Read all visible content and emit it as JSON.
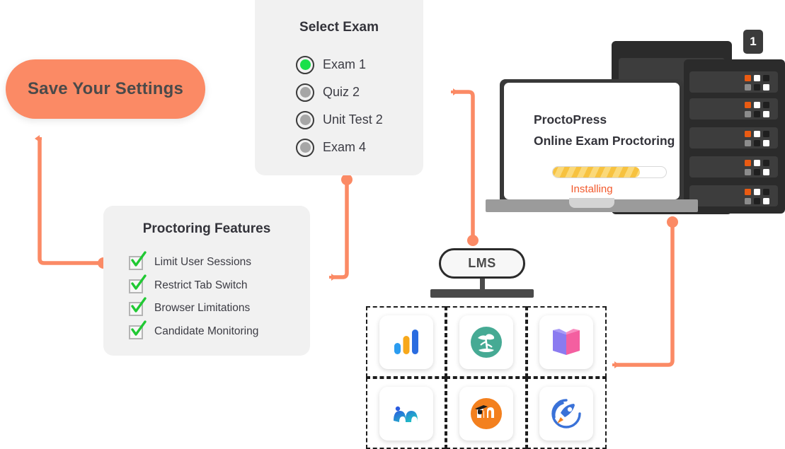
{
  "save_button": {
    "label": "Save Your Settings",
    "color": "#fb8a65"
  },
  "select_exam_card": {
    "title": "Select Exam",
    "options": [
      {
        "label": "Exam 1",
        "selected": true
      },
      {
        "label": "Quiz 2",
        "selected": false
      },
      {
        "label": "Unit Test 2",
        "selected": false
      },
      {
        "label": "Exam 4",
        "selected": false
      }
    ],
    "selected_color": "#18e049"
  },
  "features_card": {
    "title": "Proctoring Features",
    "items": [
      {
        "label": "Limit User Sessions",
        "checked": true
      },
      {
        "label": "Restrict Tab Switch",
        "checked": true
      },
      {
        "label": "Browser Limitations",
        "checked": true
      },
      {
        "label": "Candidate Monitoring",
        "checked": true
      }
    ],
    "check_color": "#20c933"
  },
  "laptop": {
    "app_name": "ProctoPress",
    "app_subtitle": "Online Exam Proctoring",
    "status": "Installing",
    "status_color": "#f2592c",
    "progress_percent": 77,
    "progress_color": "#f7c23f"
  },
  "server_badge": {
    "number": "1"
  },
  "lms": {
    "label": "LMS"
  },
  "tiles": [
    {
      "name": "bar-chart-app"
    },
    {
      "name": "bonsai-tree-app"
    },
    {
      "name": "open-book-app"
    },
    {
      "name": "wave-m-app"
    },
    {
      "name": "moodle-app"
    },
    {
      "name": "rocket-app"
    }
  ],
  "connector_color": "#fb8a65"
}
